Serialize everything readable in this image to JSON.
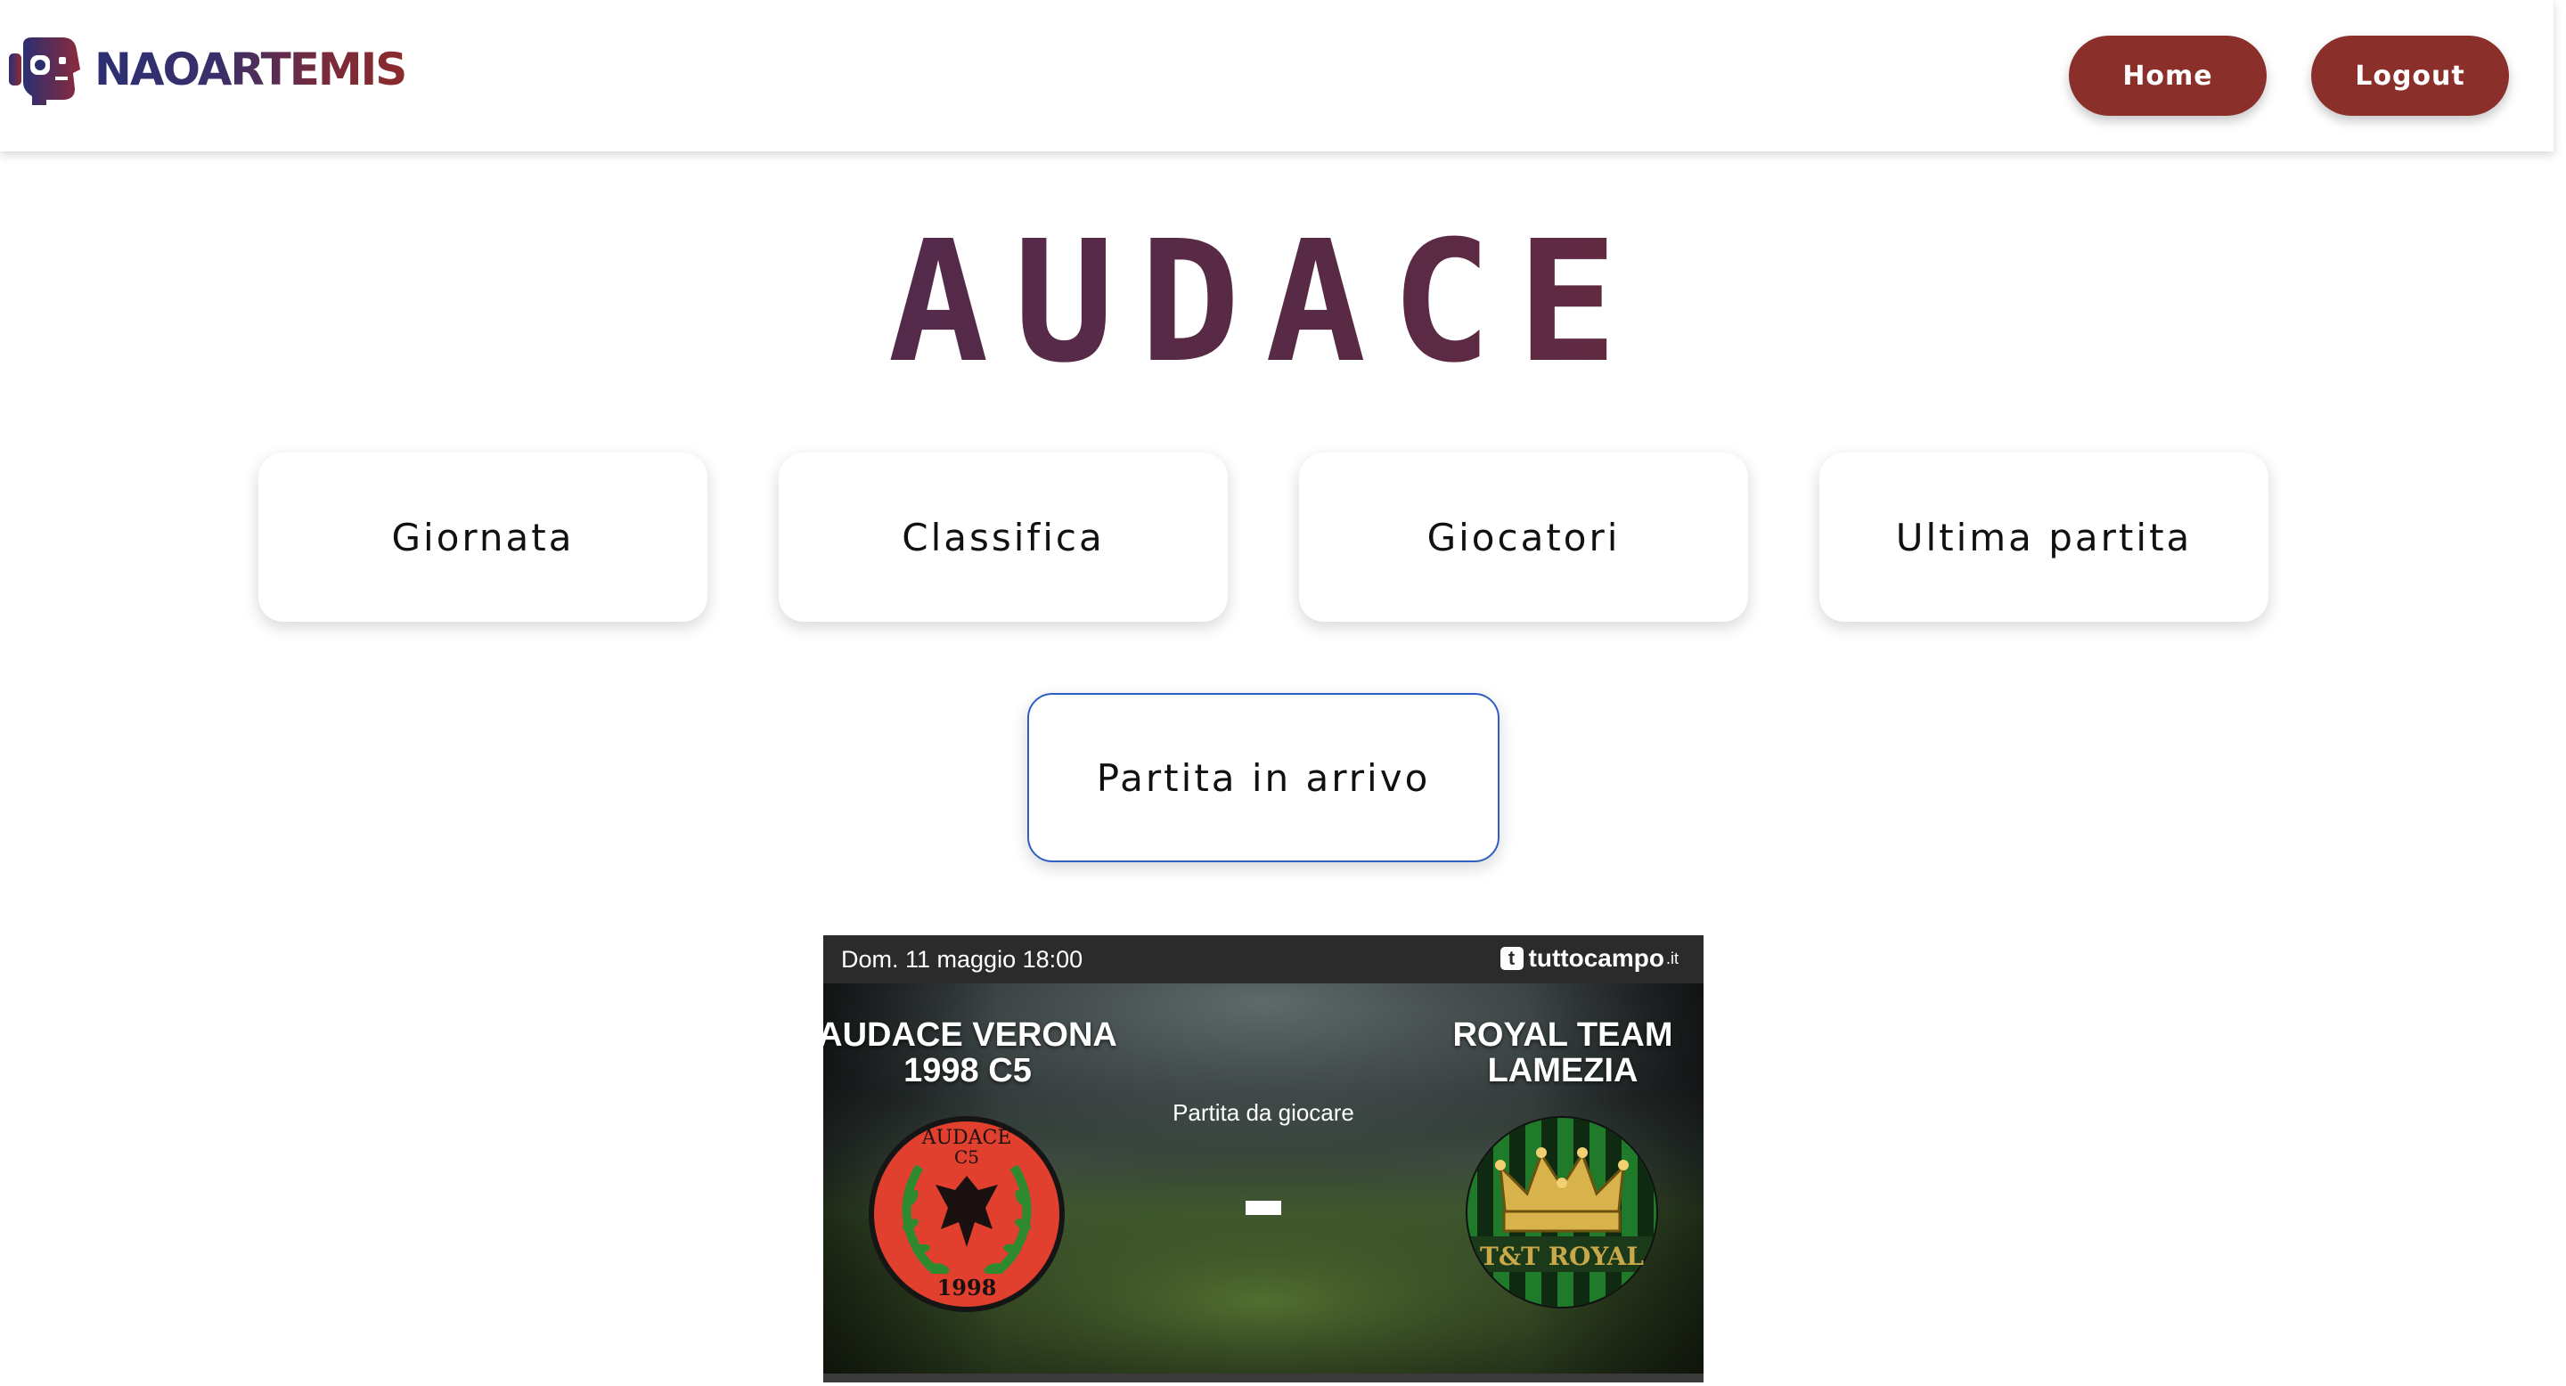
{
  "header": {
    "logo_text": "NAOARTEMIS",
    "nav": {
      "home_label": "Home",
      "logout_label": "Logout"
    }
  },
  "main": {
    "title": "AUDACE",
    "menu": [
      {
        "label": "Giornata"
      },
      {
        "label": "Classifica"
      },
      {
        "label": "Giocatori"
      },
      {
        "label": "Ultima partita"
      },
      {
        "label": "Partita in arrivo"
      }
    ]
  },
  "match_widget": {
    "date": "Dom. 11 maggio 18:00",
    "brand": "tuttocampo",
    "brand_suffix": ".it",
    "home_team": "AUDACE VERONA\n1998 C5",
    "away_team": "ROYAL TEAM\nLAMEZIA",
    "status": "Partita da giocare",
    "home_crest": {
      "top_text": "AUDACE",
      "sub_text": "C5",
      "year": "1998"
    },
    "away_crest": {
      "band_text": "T&T ROYAL"
    }
  },
  "colors": {
    "button": "#8b2f2a",
    "title_gradient": [
      "#4a2a55",
      "#7a2a35"
    ],
    "active_card_border": "#2f5fc4"
  }
}
